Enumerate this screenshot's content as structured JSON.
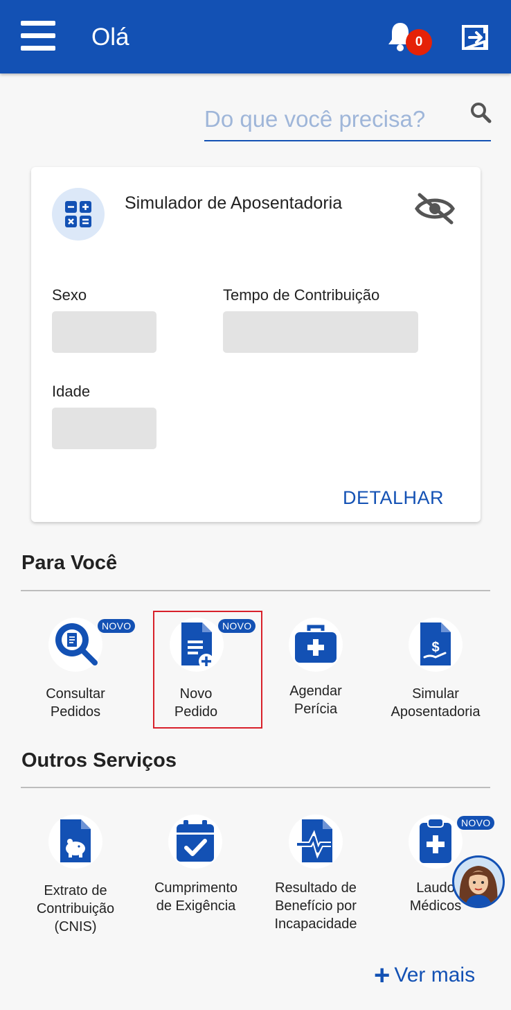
{
  "header": {
    "greeting": "Olá",
    "notification_count": "0",
    "colors": {
      "primary": "#1351b4",
      "badge": "#e52207"
    }
  },
  "search": {
    "placeholder": "Do que você precisa?"
  },
  "simulator_card": {
    "title": "Simulador de Aposentadoria",
    "fields": {
      "sexo": "Sexo",
      "tempo": "Tempo de Contribuição",
      "idade": "Idade"
    },
    "action": "DETALHAR"
  },
  "para_voce": {
    "title": "Para Você",
    "items": [
      {
        "label_1": "Consultar",
        "label_2": "Pedidos",
        "badge": "NOVO",
        "icon": "search-document-icon"
      },
      {
        "label_1": "Novo",
        "label_2": "Pedido",
        "badge": "NOVO",
        "icon": "new-document-icon"
      },
      {
        "label_1": "Agendar",
        "label_2": "Perícia",
        "icon": "medical-kit-icon"
      },
      {
        "label_1": "Simular",
        "label_2": "Aposentadoria",
        "icon": "money-document-icon"
      }
    ]
  },
  "outros": {
    "title": "Outros Serviços",
    "items": [
      {
        "label_1": "Extrato de",
        "label_2": "Contribuição",
        "label_3": "(CNIS)",
        "icon": "piggy-document-icon"
      },
      {
        "label_1": "Cumprimento",
        "label_2": "de Exigência",
        "icon": "calendar-check-icon"
      },
      {
        "label_1": "Resultado de",
        "label_2": "Benefício por",
        "label_3": "Incapacidade",
        "icon": "pulse-document-icon"
      },
      {
        "label_1": "Laudo",
        "label_2": "Médicos",
        "badge": "NOVO",
        "icon": "clipboard-medical-icon"
      }
    ]
  },
  "ver_mais": "Ver mais"
}
